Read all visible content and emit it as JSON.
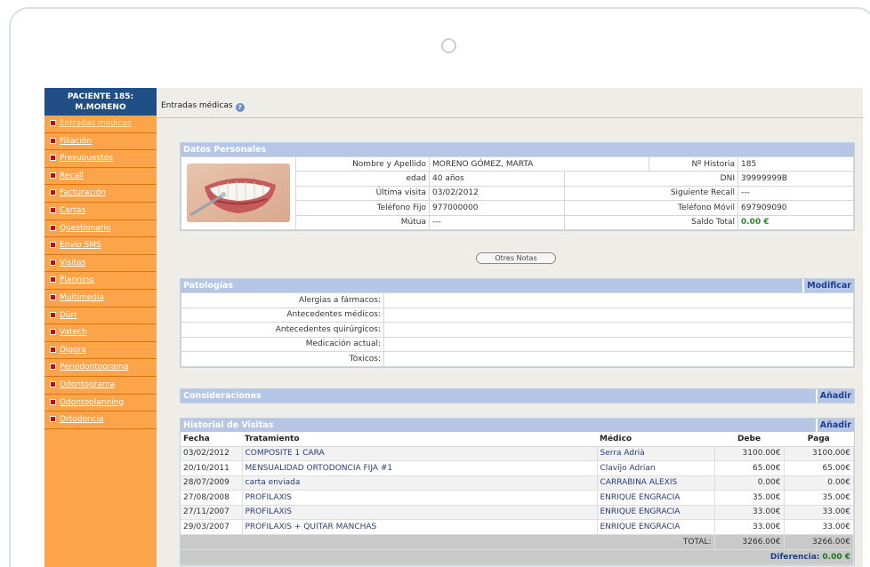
{
  "sidebar": {
    "patient_line1": "PACIENTE 185:",
    "patient_line2": "M.MORENO",
    "items": [
      {
        "label": "Entradas médicas"
      },
      {
        "label": "Filiación"
      },
      {
        "label": "Presupuestos"
      },
      {
        "label": "Recall"
      },
      {
        "label": "Facturación"
      },
      {
        "label": "Cartas"
      },
      {
        "label": "Questionario"
      },
      {
        "label": "Envio SMS"
      },
      {
        "label": "Visitas"
      },
      {
        "label": "Planning"
      },
      {
        "label": "Multimedia"
      },
      {
        "label": "Dürr"
      },
      {
        "label": "Vatech"
      },
      {
        "label": "Digora"
      },
      {
        "label": "Periodontograma"
      },
      {
        "label": "Odontograma"
      },
      {
        "label": "Odontoplanning"
      },
      {
        "label": "Ortodoncia"
      }
    ]
  },
  "topbar": {
    "title": "Entradas médicas"
  },
  "datos": {
    "title": "Datos Personales",
    "nombre_label": "Nombre y Apellido",
    "nombre": "MORENO GÓMEZ, MARTA",
    "historia_label": "Nº Historia",
    "historia": "185",
    "edad_label": "edad",
    "edad": "40 años",
    "dni_label": "DNI",
    "dni": "39999999B",
    "ultima_label": "Última visita",
    "ultima": "03/02/2012",
    "recall_label": "Siguiente Recall",
    "recall": "---",
    "fijo_label": "Teléfono Fijo",
    "fijo": "977000000",
    "movil_label": "Teléfono Móvil",
    "movil": "697909090",
    "mutua_label": "Mútua",
    "mutua": "---",
    "saldo_label": "Saldo Total",
    "saldo": "0.00 €"
  },
  "otras_notas": "Otres Notas",
  "patologias": {
    "title": "Patologías",
    "action": "Modificar",
    "rows": [
      {
        "label": "Alergias a fármacos:",
        "value": ""
      },
      {
        "label": "Antecedentes médicos:",
        "value": ""
      },
      {
        "label": "Antecedentes quirúrgicos:",
        "value": ""
      },
      {
        "label": "Medicación actual:",
        "value": ""
      },
      {
        "label": "Tóxicos:",
        "value": ""
      }
    ]
  },
  "consideraciones": {
    "title": "Consideraciones",
    "action": "Añadir"
  },
  "historial": {
    "title": "Historial de Visitas",
    "action": "Añadir",
    "columns": {
      "fecha": "Fecha",
      "tratamiento": "Tratamiento",
      "medico": "Médico",
      "debe": "Debe",
      "paga": "Paga"
    },
    "rows": [
      {
        "fecha": "03/02/2012",
        "tratamiento": "COMPOSITE 1 CARA",
        "medico": "Serra Adrià",
        "debe": "3100.00€",
        "paga": "3100.00€"
      },
      {
        "fecha": "20/10/2011",
        "tratamiento": "MENSUALIDAD ORTODONCIA FIJA #1",
        "medico": "Clavijo Adrian",
        "debe": "65.00€",
        "paga": "65.00€"
      },
      {
        "fecha": "28/07/2009",
        "tratamiento": "carta enviada",
        "medico": "CARRABINA ALEXIS",
        "debe": "0.00€",
        "paga": "0.00€"
      },
      {
        "fecha": "27/08/2008",
        "tratamiento": "PROFILAXIS",
        "medico": "ENRIQUE ENGRACIA",
        "debe": "35.00€",
        "paga": "35.00€"
      },
      {
        "fecha": "27/11/2007",
        "tratamiento": "PROFILAXIS",
        "medico": "ENRIQUE ENGRACIA",
        "debe": "33.00€",
        "paga": "33.00€"
      },
      {
        "fecha": "29/03/2007",
        "tratamiento": "PROFILAXIS + QUITAR MANCHAS",
        "medico": "ENRIQUE ENGRACIA",
        "debe": "33.00€",
        "paga": "33.00€"
      }
    ],
    "total_label": "TOTAL:",
    "total_debe": "3266.00€",
    "total_paga": "3266.00€",
    "diferencia_label": "Diferencia:",
    "diferencia": "0.00 €"
  },
  "colors": {
    "sidebar": "#fca44a",
    "header_blue": "#1f4f86",
    "panel_head": "#b5c6e7",
    "money_green": "#2a8a2a"
  }
}
